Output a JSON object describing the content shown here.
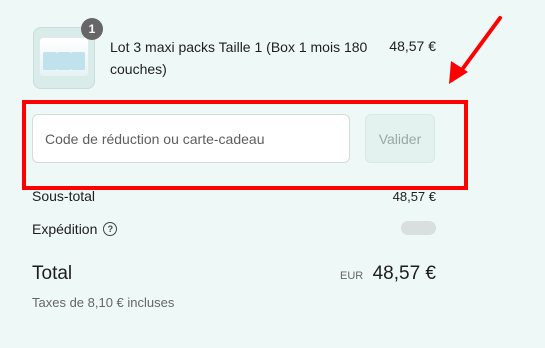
{
  "cart_item": {
    "quantity": "1",
    "name": "Lot 3 maxi packs Taille 1 (Box 1 mois 180 couches)",
    "price": "48,57 €"
  },
  "discount": {
    "placeholder": "Code de réduction ou carte-cadeau",
    "apply_label": "Valider"
  },
  "summary": {
    "subtotal_label": "Sous-total",
    "subtotal_value": "48,57 €",
    "shipping_label": "Expédition",
    "total_label": "Total",
    "currency": "EUR",
    "total_value": "48,57 €",
    "tax_note": "Taxes de 8,10 € incluses"
  },
  "colors": {
    "background": "#eef8f6",
    "annotation": "#ff0000"
  }
}
